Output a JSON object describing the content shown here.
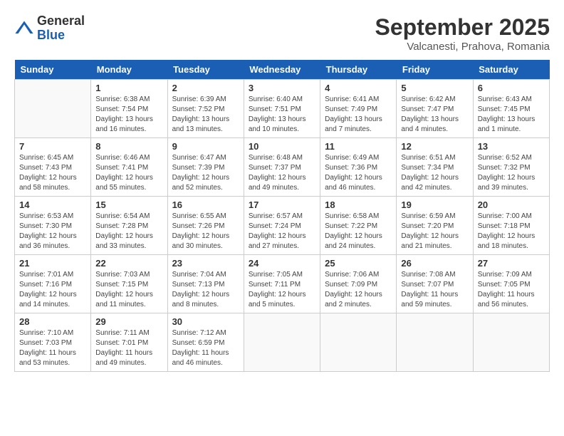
{
  "logo": {
    "general": "General",
    "blue": "Blue"
  },
  "header": {
    "month": "September 2025",
    "location": "Valcanesti, Prahova, Romania"
  },
  "days_of_week": [
    "Sunday",
    "Monday",
    "Tuesday",
    "Wednesday",
    "Thursday",
    "Friday",
    "Saturday"
  ],
  "weeks": [
    [
      {
        "day": "",
        "info": ""
      },
      {
        "day": "1",
        "info": "Sunrise: 6:38 AM\nSunset: 7:54 PM\nDaylight: 13 hours\nand 16 minutes."
      },
      {
        "day": "2",
        "info": "Sunrise: 6:39 AM\nSunset: 7:52 PM\nDaylight: 13 hours\nand 13 minutes."
      },
      {
        "day": "3",
        "info": "Sunrise: 6:40 AM\nSunset: 7:51 PM\nDaylight: 13 hours\nand 10 minutes."
      },
      {
        "day": "4",
        "info": "Sunrise: 6:41 AM\nSunset: 7:49 PM\nDaylight: 13 hours\nand 7 minutes."
      },
      {
        "day": "5",
        "info": "Sunrise: 6:42 AM\nSunset: 7:47 PM\nDaylight: 13 hours\nand 4 minutes."
      },
      {
        "day": "6",
        "info": "Sunrise: 6:43 AM\nSunset: 7:45 PM\nDaylight: 13 hours\nand 1 minute."
      }
    ],
    [
      {
        "day": "7",
        "info": "Sunrise: 6:45 AM\nSunset: 7:43 PM\nDaylight: 12 hours\nand 58 minutes."
      },
      {
        "day": "8",
        "info": "Sunrise: 6:46 AM\nSunset: 7:41 PM\nDaylight: 12 hours\nand 55 minutes."
      },
      {
        "day": "9",
        "info": "Sunrise: 6:47 AM\nSunset: 7:39 PM\nDaylight: 12 hours\nand 52 minutes."
      },
      {
        "day": "10",
        "info": "Sunrise: 6:48 AM\nSunset: 7:37 PM\nDaylight: 12 hours\nand 49 minutes."
      },
      {
        "day": "11",
        "info": "Sunrise: 6:49 AM\nSunset: 7:36 PM\nDaylight: 12 hours\nand 46 minutes."
      },
      {
        "day": "12",
        "info": "Sunrise: 6:51 AM\nSunset: 7:34 PM\nDaylight: 12 hours\nand 42 minutes."
      },
      {
        "day": "13",
        "info": "Sunrise: 6:52 AM\nSunset: 7:32 PM\nDaylight: 12 hours\nand 39 minutes."
      }
    ],
    [
      {
        "day": "14",
        "info": "Sunrise: 6:53 AM\nSunset: 7:30 PM\nDaylight: 12 hours\nand 36 minutes."
      },
      {
        "day": "15",
        "info": "Sunrise: 6:54 AM\nSunset: 7:28 PM\nDaylight: 12 hours\nand 33 minutes."
      },
      {
        "day": "16",
        "info": "Sunrise: 6:55 AM\nSunset: 7:26 PM\nDaylight: 12 hours\nand 30 minutes."
      },
      {
        "day": "17",
        "info": "Sunrise: 6:57 AM\nSunset: 7:24 PM\nDaylight: 12 hours\nand 27 minutes."
      },
      {
        "day": "18",
        "info": "Sunrise: 6:58 AM\nSunset: 7:22 PM\nDaylight: 12 hours\nand 24 minutes."
      },
      {
        "day": "19",
        "info": "Sunrise: 6:59 AM\nSunset: 7:20 PM\nDaylight: 12 hours\nand 21 minutes."
      },
      {
        "day": "20",
        "info": "Sunrise: 7:00 AM\nSunset: 7:18 PM\nDaylight: 12 hours\nand 18 minutes."
      }
    ],
    [
      {
        "day": "21",
        "info": "Sunrise: 7:01 AM\nSunset: 7:16 PM\nDaylight: 12 hours\nand 14 minutes."
      },
      {
        "day": "22",
        "info": "Sunrise: 7:03 AM\nSunset: 7:15 PM\nDaylight: 12 hours\nand 11 minutes."
      },
      {
        "day": "23",
        "info": "Sunrise: 7:04 AM\nSunset: 7:13 PM\nDaylight: 12 hours\nand 8 minutes."
      },
      {
        "day": "24",
        "info": "Sunrise: 7:05 AM\nSunset: 7:11 PM\nDaylight: 12 hours\nand 5 minutes."
      },
      {
        "day": "25",
        "info": "Sunrise: 7:06 AM\nSunset: 7:09 PM\nDaylight: 12 hours\nand 2 minutes."
      },
      {
        "day": "26",
        "info": "Sunrise: 7:08 AM\nSunset: 7:07 PM\nDaylight: 11 hours\nand 59 minutes."
      },
      {
        "day": "27",
        "info": "Sunrise: 7:09 AM\nSunset: 7:05 PM\nDaylight: 11 hours\nand 56 minutes."
      }
    ],
    [
      {
        "day": "28",
        "info": "Sunrise: 7:10 AM\nSunset: 7:03 PM\nDaylight: 11 hours\nand 53 minutes."
      },
      {
        "day": "29",
        "info": "Sunrise: 7:11 AM\nSunset: 7:01 PM\nDaylight: 11 hours\nand 49 minutes."
      },
      {
        "day": "30",
        "info": "Sunrise: 7:12 AM\nSunset: 6:59 PM\nDaylight: 11 hours\nand 46 minutes."
      },
      {
        "day": "",
        "info": ""
      },
      {
        "day": "",
        "info": ""
      },
      {
        "day": "",
        "info": ""
      },
      {
        "day": "",
        "info": ""
      }
    ]
  ]
}
